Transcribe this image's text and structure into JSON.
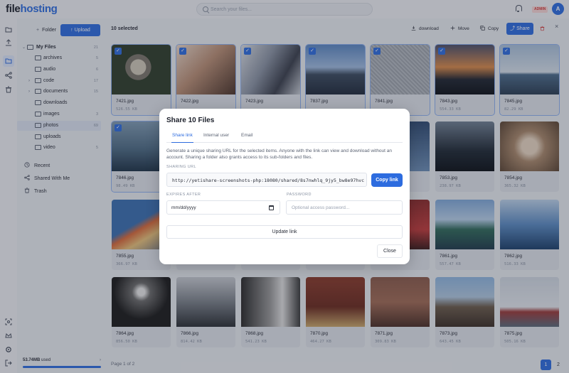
{
  "app": {
    "logo_primary": "file",
    "logo_accent": "hosting",
    "accent_color": "#2d6cdf"
  },
  "header": {
    "search_placeholder": "Search your files...",
    "admin_badge": "ADMIN",
    "avatar_initial": "A"
  },
  "sidebar": {
    "folder_button": "Folder",
    "upload_button": "Upload",
    "root": {
      "label": "My Files",
      "count": "21"
    },
    "folders": [
      {
        "label": "archives",
        "count": "5"
      },
      {
        "label": "audio",
        "count": "6"
      },
      {
        "label": "code",
        "count": "17"
      },
      {
        "label": "documents",
        "count": "15"
      },
      {
        "label": "downloads",
        "count": ""
      },
      {
        "label": "images",
        "count": "3"
      },
      {
        "label": "photos",
        "count": "69"
      },
      {
        "label": "uploads",
        "count": ""
      },
      {
        "label": "video",
        "count": "5"
      }
    ],
    "nav": [
      {
        "label": "Recent",
        "icon": "clock-icon"
      },
      {
        "label": "Shared With Me",
        "icon": "users-icon"
      },
      {
        "label": "Trash",
        "icon": "trash-icon"
      }
    ],
    "storage_used": "53.74MB",
    "storage_suffix": " used"
  },
  "toolbar": {
    "selected_text": "10 selected",
    "download": "download",
    "move": "Move",
    "copy": "Copy",
    "share": "Share"
  },
  "files": [
    {
      "name": "7421.jpg",
      "size": "526.55 KB",
      "checked": true,
      "img": "lemur"
    },
    {
      "name": "7422.jpg",
      "size": "",
      "checked": true,
      "img": "woman"
    },
    {
      "name": "7423.jpg",
      "size": "",
      "checked": true,
      "img": "phone"
    },
    {
      "name": "7837.jpg",
      "size": "",
      "checked": true,
      "img": "city"
    },
    {
      "name": "7841.jpg",
      "size": "",
      "checked": true,
      "img": "gray"
    },
    {
      "name": "7843.jpg",
      "size": "554.33 KB",
      "checked": true,
      "img": "sunset"
    },
    {
      "name": "7845.jpg",
      "size": "82.29 KB",
      "checked": true,
      "img": "ship"
    },
    {
      "name": "7846.jpg",
      "size": "98.49 KB",
      "checked": true,
      "img": "sea"
    },
    {
      "name": "",
      "size": "",
      "checked": false,
      "img": "blank"
    },
    {
      "name": "",
      "size": "",
      "checked": false,
      "img": "blank"
    },
    {
      "name": "",
      "size": "",
      "checked": false,
      "img": "blank"
    },
    {
      "name": "",
      "size": "",
      "checked": false,
      "img": "bluish"
    },
    {
      "name": "7853.jpg",
      "size": "238.97 KB",
      "checked": false,
      "img": "dusk"
    },
    {
      "name": "7854.jpg",
      "size": "365.32 KB",
      "checked": false,
      "img": "arch"
    },
    {
      "name": "7855.jpg",
      "size": "366.97 KB",
      "checked": false,
      "img": "pencils"
    },
    {
      "name": "",
      "size": "",
      "checked": false,
      "img": "blank"
    },
    {
      "name": "",
      "size": "",
      "checked": false,
      "img": "blank"
    },
    {
      "name": "",
      "size": "",
      "checked": false,
      "img": "blank"
    },
    {
      "name": "",
      "size": "",
      "checked": false,
      "img": "red"
    },
    {
      "name": "7861.jpg",
      "size": "557.47 KB",
      "checked": false,
      "img": "coast"
    },
    {
      "name": "7862.jpg",
      "size": "516.33 KB",
      "checked": false,
      "img": "wave"
    },
    {
      "name": "7864.jpg",
      "size": "856.50 KB",
      "checked": false,
      "img": "night"
    },
    {
      "name": "7866.jpg",
      "size": "814.42 KB",
      "checked": false,
      "img": "falls"
    },
    {
      "name": "7868.jpg",
      "size": "541.23 KB",
      "checked": false,
      "img": "bw"
    },
    {
      "name": "7870.jpg",
      "size": "464.27 KB",
      "checked": false,
      "img": "clock"
    },
    {
      "name": "7871.jpg",
      "size": "309.83 KB",
      "checked": false,
      "img": "bridge"
    },
    {
      "name": "7873.jpg",
      "size": "643.45 KB",
      "checked": false,
      "img": "arena"
    },
    {
      "name": "7875.jpg",
      "size": "505.16 KB",
      "checked": false,
      "img": "boat"
    }
  ],
  "pagination": {
    "label": "Page 1 of 2",
    "current": "1",
    "next": "2"
  },
  "modal": {
    "title": "Share 10 Files",
    "tabs": [
      "Share link",
      "Internal user",
      "Email"
    ],
    "description": "Generate a unique sharing URL for the selected items. Anyone with the link can view and download without an account. Sharing a folder also grants access to its sub-folders and files.",
    "url_label": "SHARING URL",
    "url_value": "http://yetishare-screenshots-php:18080/shared/8s7nwhlq_9jy5_bw8e97hvcwiun",
    "copy_button": "Copy link",
    "expires_label": "EXPIRES AFTER",
    "expires_value": "mm/dd/yyyy",
    "password_label": "PASSWORD",
    "password_placeholder": "Optional access password...",
    "update_button": "Update link",
    "close_button": "Close"
  }
}
